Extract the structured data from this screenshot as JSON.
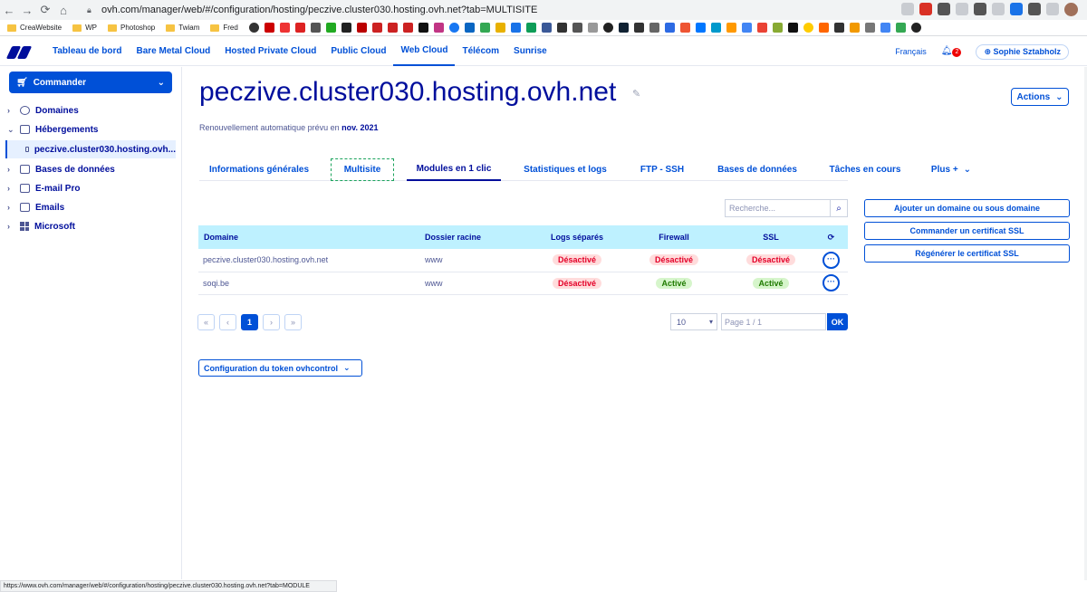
{
  "browser": {
    "url": "ovh.com/manager/web/#/configuration/hosting/peczive.cluster030.hosting.ovh.net?tab=MULTISITE",
    "bookmarks": [
      "CreaWebsite",
      "WP",
      "Photoshop",
      "Twiam",
      "Fred"
    ],
    "status_url": "https://www.ovh.com/manager/web/#/configuration/hosting/peczive.cluster030.hosting.ovh.net?tab=MODULE"
  },
  "topnav": {
    "items": [
      "Tableau de bord",
      "Bare Metal Cloud",
      "Hosted Private Cloud",
      "Public Cloud",
      "Web Cloud",
      "Télécom",
      "Sunrise"
    ],
    "language": "Français",
    "notifications": "2",
    "user": "Sophie Sztabholz"
  },
  "sidebar": {
    "commander": "Commander",
    "items": [
      "Domaines",
      "Hébergements",
      "Bases de données",
      "E-mail Pro",
      "Emails",
      "Microsoft"
    ],
    "selected": "peczive.cluster030.hosting.ovh..."
  },
  "header": {
    "title": "peczive.cluster030.hosting.ovh.net",
    "actions": "Actions",
    "renewal_prefix": "Renouvellement automatique prévu en",
    "renewal_date": "nov. 2021"
  },
  "tabs": [
    "Informations générales",
    "Multisite",
    "Modules en 1 clic",
    "Statistiques et logs",
    "FTP - SSH",
    "Bases de données",
    "Tâches en cours",
    "Plus +"
  ],
  "search": {
    "placeholder": "Recherche..."
  },
  "table": {
    "columns": [
      "Domaine",
      "Dossier racine",
      "Logs séparés",
      "Firewall",
      "SSL"
    ],
    "rows": [
      {
        "domain": "peczive.cluster030.hosting.ovh.net",
        "root": "www",
        "logs": "Désactivé",
        "firewall": "Désactivé",
        "ssl": "Désactivé"
      },
      {
        "domain": "soqi.be",
        "root": "www",
        "logs": "Désactivé",
        "firewall": "Activé",
        "ssl": "Activé"
      }
    ]
  },
  "side_actions": [
    "Ajouter un domaine ou sous domaine",
    "Commander un certificat SSL",
    "Régénérer le certificat SSL"
  ],
  "pagination": {
    "first": "«",
    "prev": "‹",
    "current": "1",
    "next": "›",
    "last": "»",
    "per_page": "10",
    "page_placeholder": "Page 1 / 1",
    "ok": "OK"
  },
  "token_button": "Configuration du token ovhcontrol",
  "colors": {
    "primary": "#0050d7",
    "navy": "#000e9c",
    "header_bg": "#bef1ff",
    "inactive": "#e40028",
    "active": "#1f7a00"
  }
}
